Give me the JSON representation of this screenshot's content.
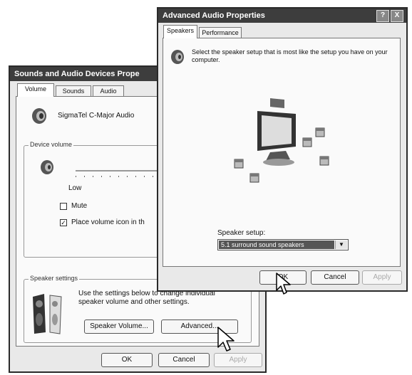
{
  "back_window": {
    "title": "Sounds and Audio Devices Prope",
    "tabs": [
      "Volume",
      "Sounds",
      "Audio"
    ],
    "device_name": "SigmaTel C-Major Audio",
    "device_volume_label": "Device volume",
    "slider_low_label": "Low",
    "mute_label": "Mute",
    "mute_checked": false,
    "place_icon_label": "Place volume icon in th",
    "place_icon_checked": true,
    "speaker_settings_label": "Speaker settings",
    "speaker_settings_text": "Use the settings below to change individual speaker volume and other settings.",
    "speaker_volume_button": "Speaker Volume...",
    "advanced_button": "Advanced...",
    "ok_button": "OK",
    "cancel_button": "Cancel",
    "apply_button": "Apply"
  },
  "front_window": {
    "title": "Advanced Audio Properties",
    "help_button": "?",
    "close_button": "X",
    "tabs": [
      "Speakers",
      "Performance"
    ],
    "description": "Select the speaker setup that is most like the setup you have on your computer.",
    "speaker_setup_label": "Speaker setup:",
    "speaker_setup_value": "5.1 surround sound speakers",
    "ok_button": "OK",
    "cancel_button": "Cancel",
    "apply_button": "Apply"
  }
}
